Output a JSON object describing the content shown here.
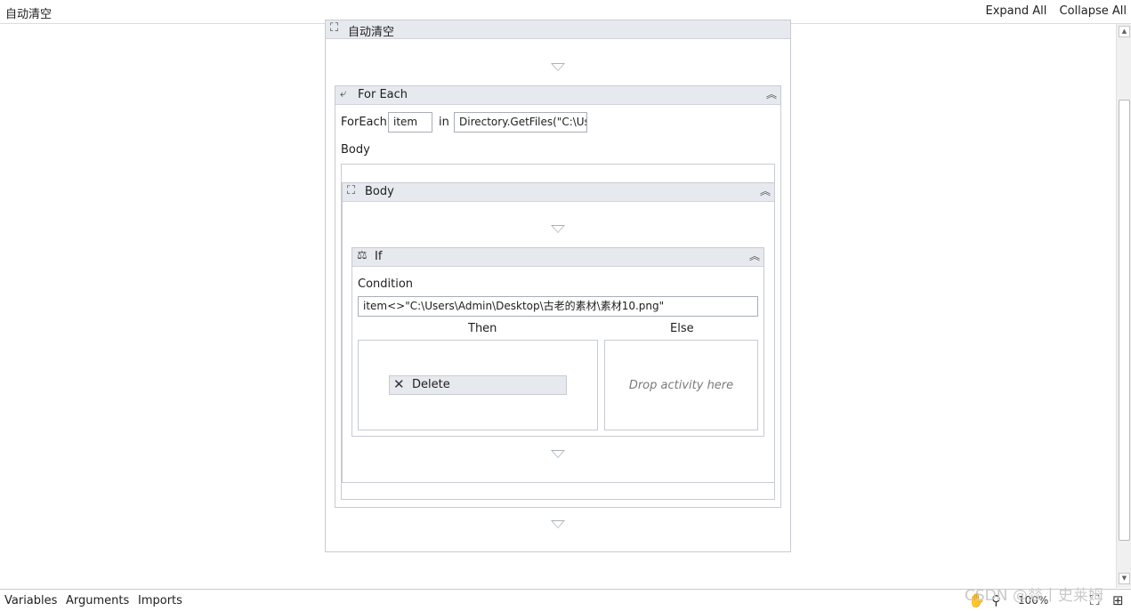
{
  "topbar": {
    "title": "自动清空",
    "expand_all": "Expand All",
    "collapse_all": "Collapse All"
  },
  "sequence": {
    "title": "自动清空"
  },
  "foreach": {
    "title": "For Each",
    "foreach_label": "ForEach",
    "item_value": "item",
    "in_label": "in",
    "values_expr": "Directory.GetFiles(\"C:\\Us",
    "body_label": "Body"
  },
  "body_sequence": {
    "title": "Body"
  },
  "if_activity": {
    "title": "If",
    "condition_label": "Condition",
    "condition_value": "item<>\"C:\\Users\\Admin\\Desktop\\古老的素材\\素材10.png\"",
    "then_label": "Then",
    "else_label": "Else",
    "drop_hint": "Drop activity here"
  },
  "delete_activity": {
    "title": "Delete"
  },
  "bottombar": {
    "variables": "Variables",
    "arguments": "Arguments",
    "imports": "Imports",
    "zoom": "100%"
  },
  "watermark": "CSDN @燚丨史莱姆",
  "icons": {
    "sequence": "sequence-icon",
    "foreach": "foreach-icon",
    "if": "if-icon",
    "delete": "delete-x-icon",
    "collapse": "double-chevron-up-icon"
  }
}
